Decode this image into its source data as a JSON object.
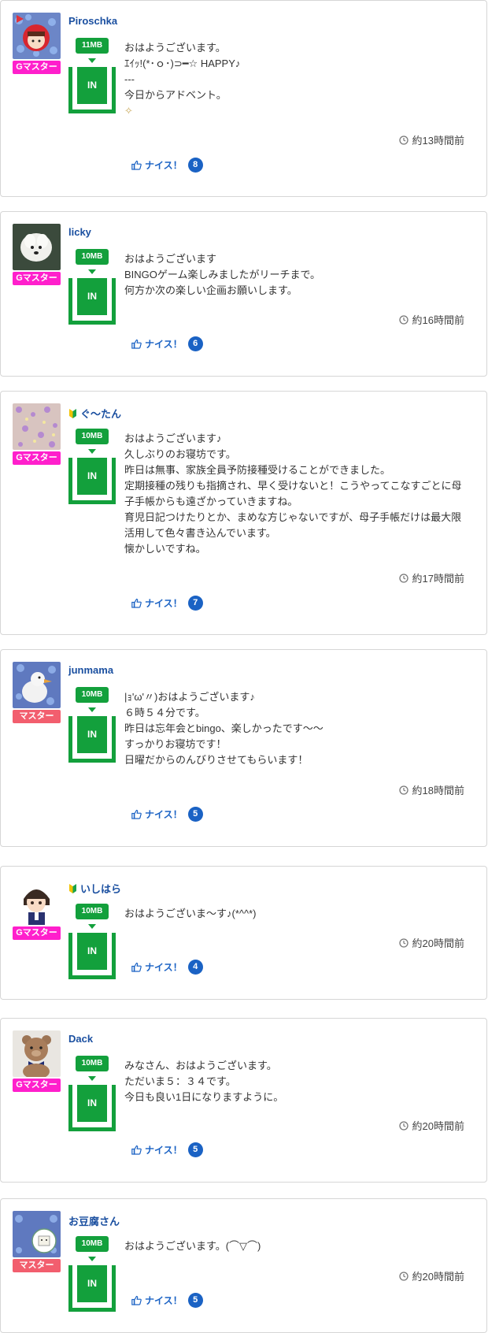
{
  "colors": {
    "g_master": "#ff1fcc",
    "master": "#f25e6e",
    "mb_green": "#13a03c",
    "link_blue": "#1a4fa0",
    "nice_blue": "#1a62c4"
  },
  "posts": [
    {
      "username": "Piroschka",
      "beginner": false,
      "rank": "Gマスター",
      "rank_type": "g_master",
      "avatar": "red-hood-girl-on-flowers",
      "mb": "11MB",
      "in_label": "IN",
      "message": [
        "おはようございます。",
        "ｴｲｯ!(*･ｏ･)⊃━☆ HAPPY♪",
        "---",
        "今日からアドベント。"
      ],
      "has_sparkle": true,
      "sparkle_glyph": "✧",
      "time": "約13時間前",
      "nice_label": "ナイス！",
      "nice_count": "8"
    },
    {
      "username": "licky",
      "beginner": false,
      "rank": "Gマスター",
      "rank_type": "g_master",
      "avatar": "white-dog",
      "mb": "10MB",
      "in_label": "IN",
      "message": [
        "おはようございます",
        "BINGOゲーム楽しみましたがリーチまで。",
        "何方か次の楽しい企画お願いします。"
      ],
      "has_sparkle": false,
      "time": "約16時間前",
      "nice_label": "ナイス！",
      "nice_count": "6"
    },
    {
      "username": "ぐ〜たん",
      "beginner": true,
      "rank": "Gマスター",
      "rank_type": "g_master",
      "avatar": "glitter-pattern",
      "mb": "10MB",
      "in_label": "IN",
      "message": [
        "おはようございます♪",
        "久しぶりのお寝坊です。",
        "昨日は無事、家族全員予防接種受けることができました。",
        "定期接種の残りも指摘され、早く受けないと！こうやってこなすごとに母子手帳からも遠ざかっていきますね。",
        "育児日記つけたりとか、まめな方じゃないですが、母子手帳だけは最大限活用して色々書き込んでいます。",
        "懐かしいですね。"
      ],
      "has_sparkle": false,
      "time": "約17時間前",
      "nice_label": "ナイス！",
      "nice_count": "7"
    },
    {
      "username": "junmama",
      "beginner": false,
      "rank": "マスター",
      "rank_type": "master",
      "avatar": "bird-on-flowers",
      "mb": "10MB",
      "in_label": "IN",
      "message": [
        "|ｮ'ω'〃)おはようございます♪",
        "６時５４分です。",
        "昨日は忘年会とbingo、楽しかったです〜〜",
        "すっかりお寝坊です！",
        "日曜だからのんびりさせてもらいます！"
      ],
      "has_sparkle": false,
      "time": "約18時間前",
      "nice_label": "ナイス！",
      "nice_count": "5"
    },
    {
      "username": "いしはら",
      "beginner": true,
      "rank": "Gマスター",
      "rank_type": "g_master",
      "avatar": "anime-boy",
      "mb": "10MB",
      "in_label": "IN",
      "message": [
        "おはようございま〜す♪(*^^*)"
      ],
      "has_sparkle": false,
      "time": "約20時間前",
      "nice_label": "ナイス！",
      "nice_count": "4"
    },
    {
      "username": "Dack",
      "beginner": false,
      "rank": "Gマスター",
      "rank_type": "g_master",
      "avatar": "teddy-bear",
      "mb": "10MB",
      "in_label": "IN",
      "message": [
        "みなさん、おはようございます。",
        "ただいま５：３４です。",
        "今日も良い1日になりますように。"
      ],
      "has_sparkle": false,
      "time": "約20時間前",
      "nice_label": "ナイス！",
      "nice_count": "5"
    },
    {
      "username": "お豆腐さん",
      "beginner": false,
      "rank": "マスター",
      "rank_type": "master",
      "avatar": "tofu-on-flowers",
      "mb": "10MB",
      "in_label": "IN",
      "message": [
        "おはようございます。(⌒▽⌒)"
      ],
      "has_sparkle": false,
      "time": "約20時間前",
      "nice_label": "ナイス！",
      "nice_count": "5"
    }
  ]
}
